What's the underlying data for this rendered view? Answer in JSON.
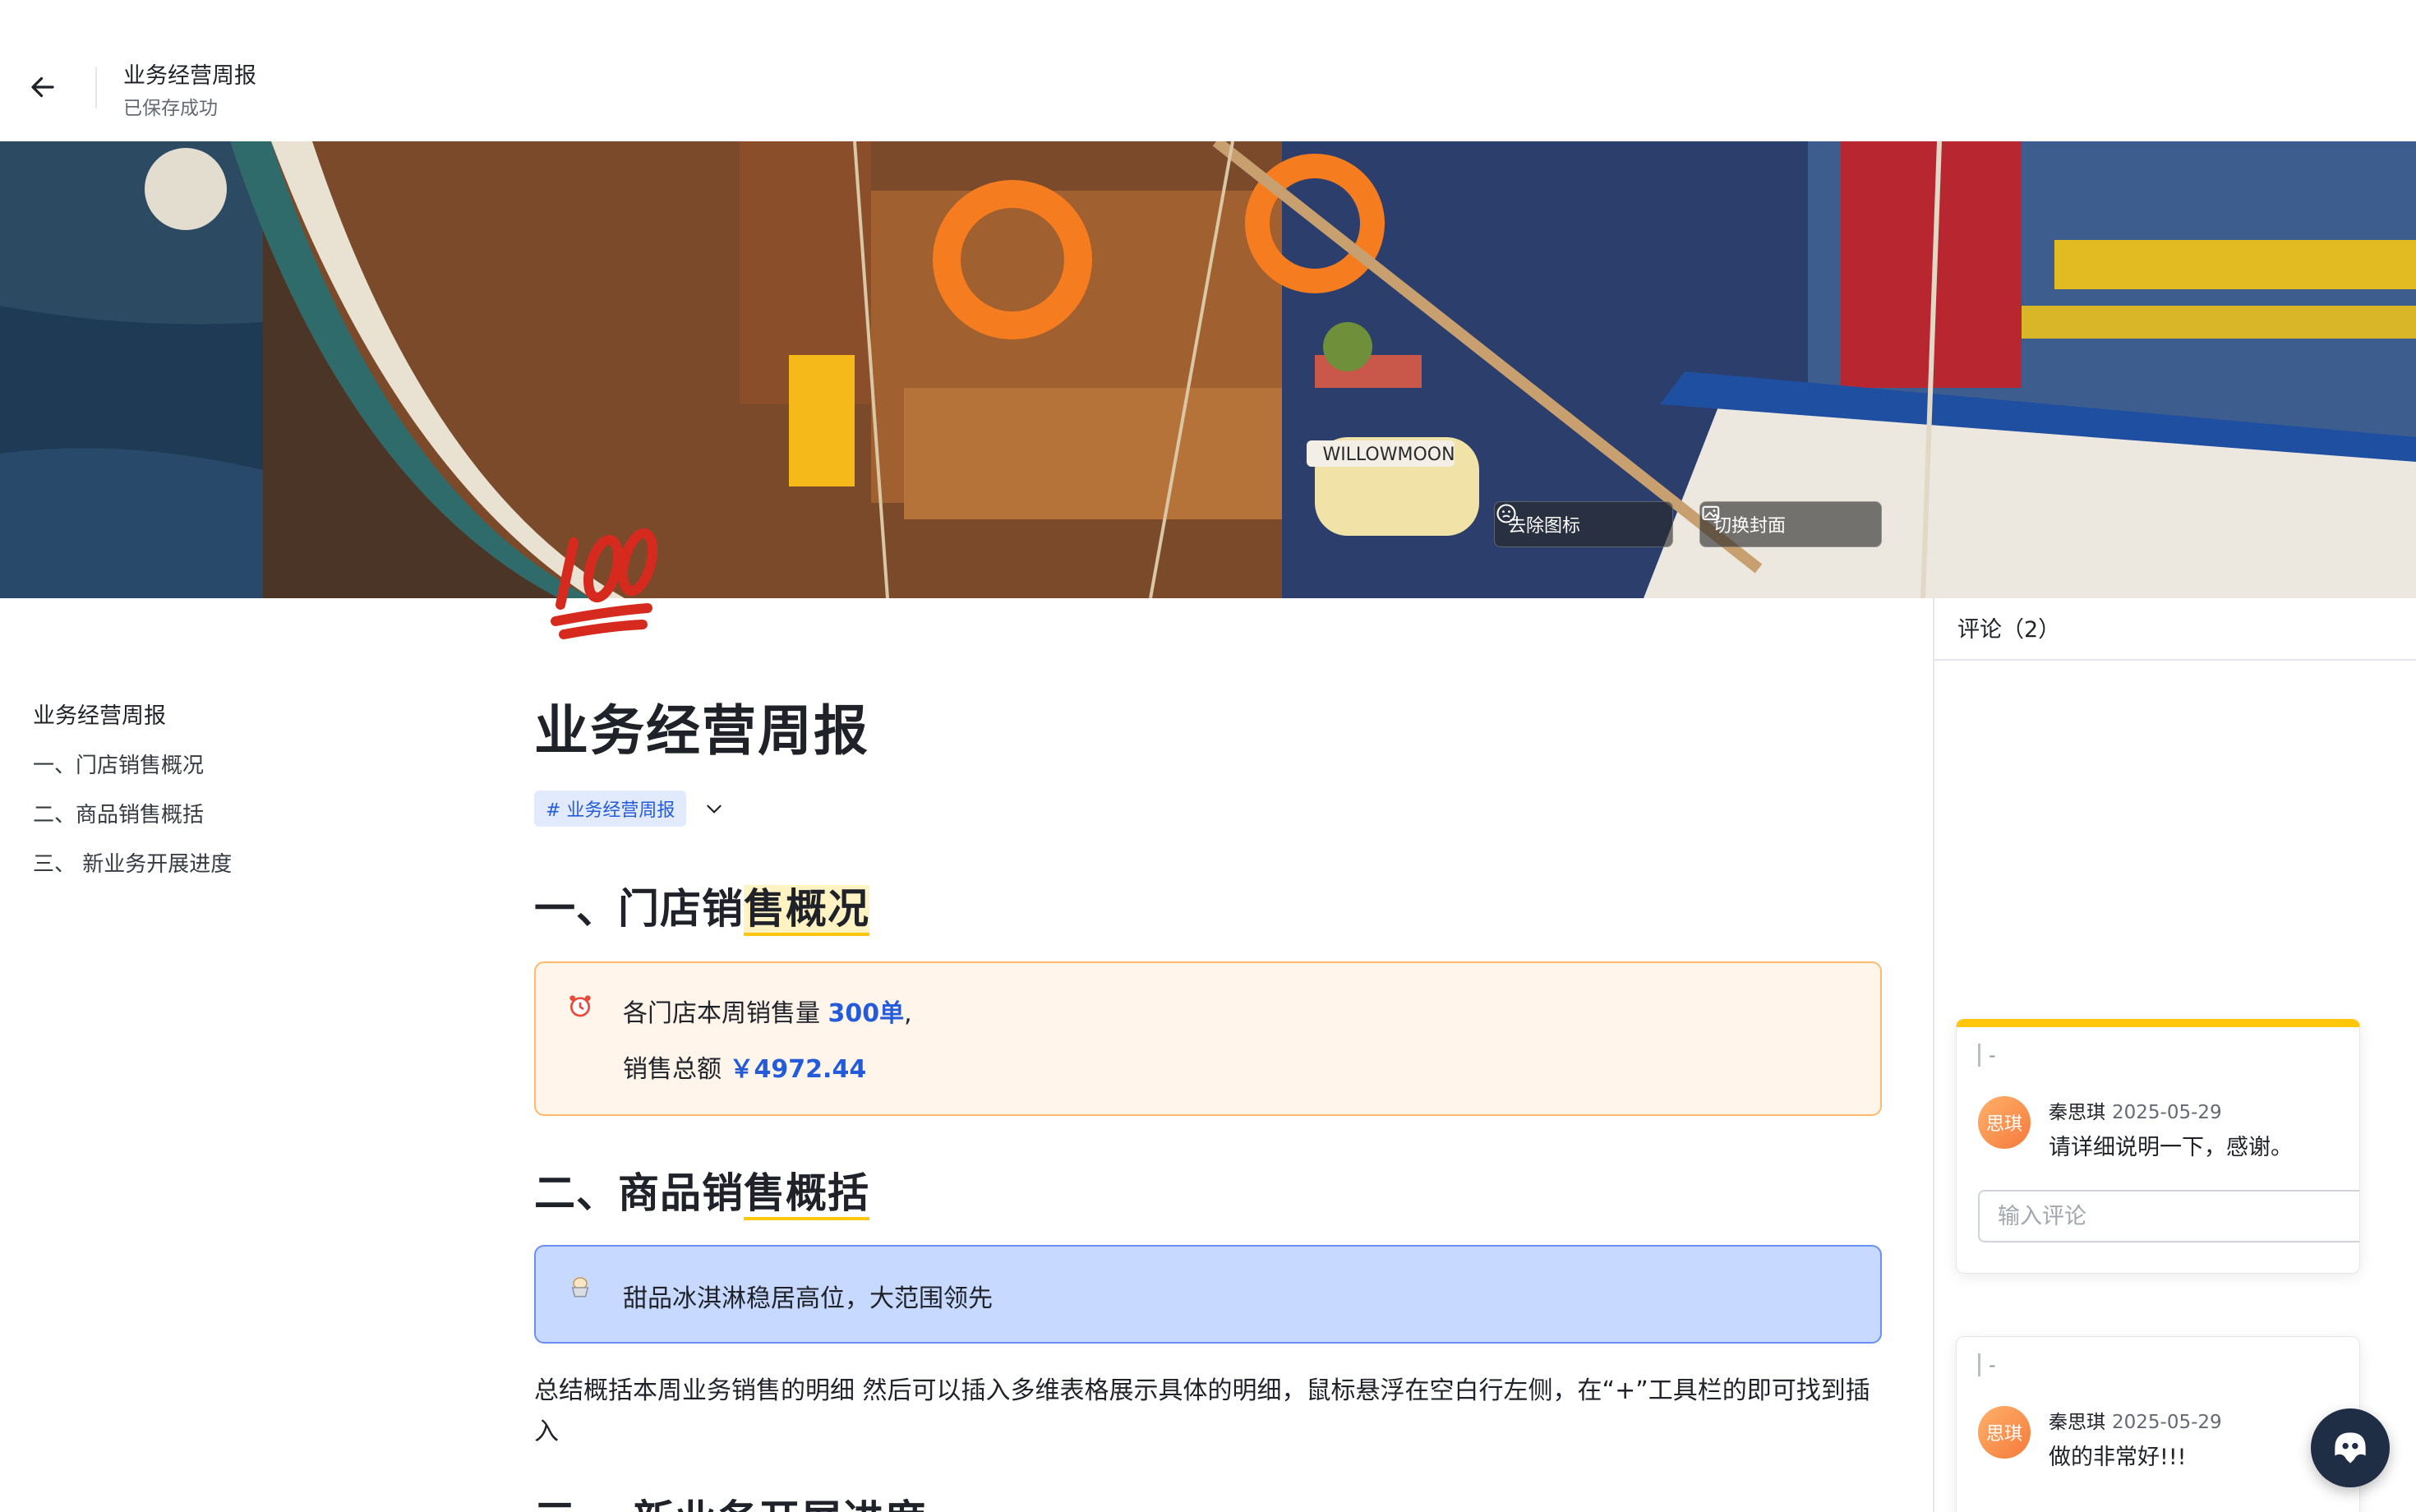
{
  "header": {
    "back_icon": "arrow-left-icon",
    "title": "业务经营周报",
    "save_status": "已保存成功"
  },
  "cover": {
    "boat_nameplate": "WILLOWMOON",
    "remove_icon_label": "去除图标",
    "switch_cover_label": "切换封面"
  },
  "page_icon": "hundred-points-icon",
  "outline": {
    "items": [
      {
        "label": "业务经营周报"
      },
      {
        "label": "一、门店销售概况"
      },
      {
        "label": "二、商品销售概括"
      },
      {
        "label": "三、 新业务开展进度"
      }
    ]
  },
  "document": {
    "title": "业务经营周报",
    "tag": "# 业务经营周报",
    "section1": {
      "prefix": "一、门店销",
      "highlight": "售概况"
    },
    "callout1": {
      "icon": "alarm-clock-icon",
      "line1_text": "各门店本周销售量",
      "line1_value": "300单",
      "line1_suffix": ",",
      "line2_text": "销售总额",
      "line2_value": "￥4972.44"
    },
    "section2": {
      "prefix": "二、商品销",
      "highlight": "售概括"
    },
    "callout2": {
      "icon": "ice-cream-icon",
      "text": "甜品冰淇淋稳居高位，大范围领先"
    },
    "paragraph": "总结概括本周业务销售的明细 然后可以插入多维表格展示具体的明细，鼠标悬浮在空白行左侧，在“+”工具栏的即可找到插入",
    "section3_partial": "三、 新业务开展进度"
  },
  "comments": {
    "title": "评论（2）",
    "items": [
      {
        "quote": "-",
        "avatar": "思琪",
        "author": "秦思琪",
        "date": "2025-05-29",
        "text": "请详细说明一下，感谢。"
      },
      {
        "quote": "-",
        "avatar": "思琪",
        "author": "秦思琪",
        "date": "2025-05-29",
        "text": "做的非常好!!!"
      }
    ],
    "input_placeholder": "输入评论"
  },
  "colors": {
    "accent_blue": "#245bdb",
    "highlight_yellow": "#ffc60a",
    "callout_orange_bg": "#fff5eb",
    "callout_blue_bg": "#c8d9ff"
  }
}
